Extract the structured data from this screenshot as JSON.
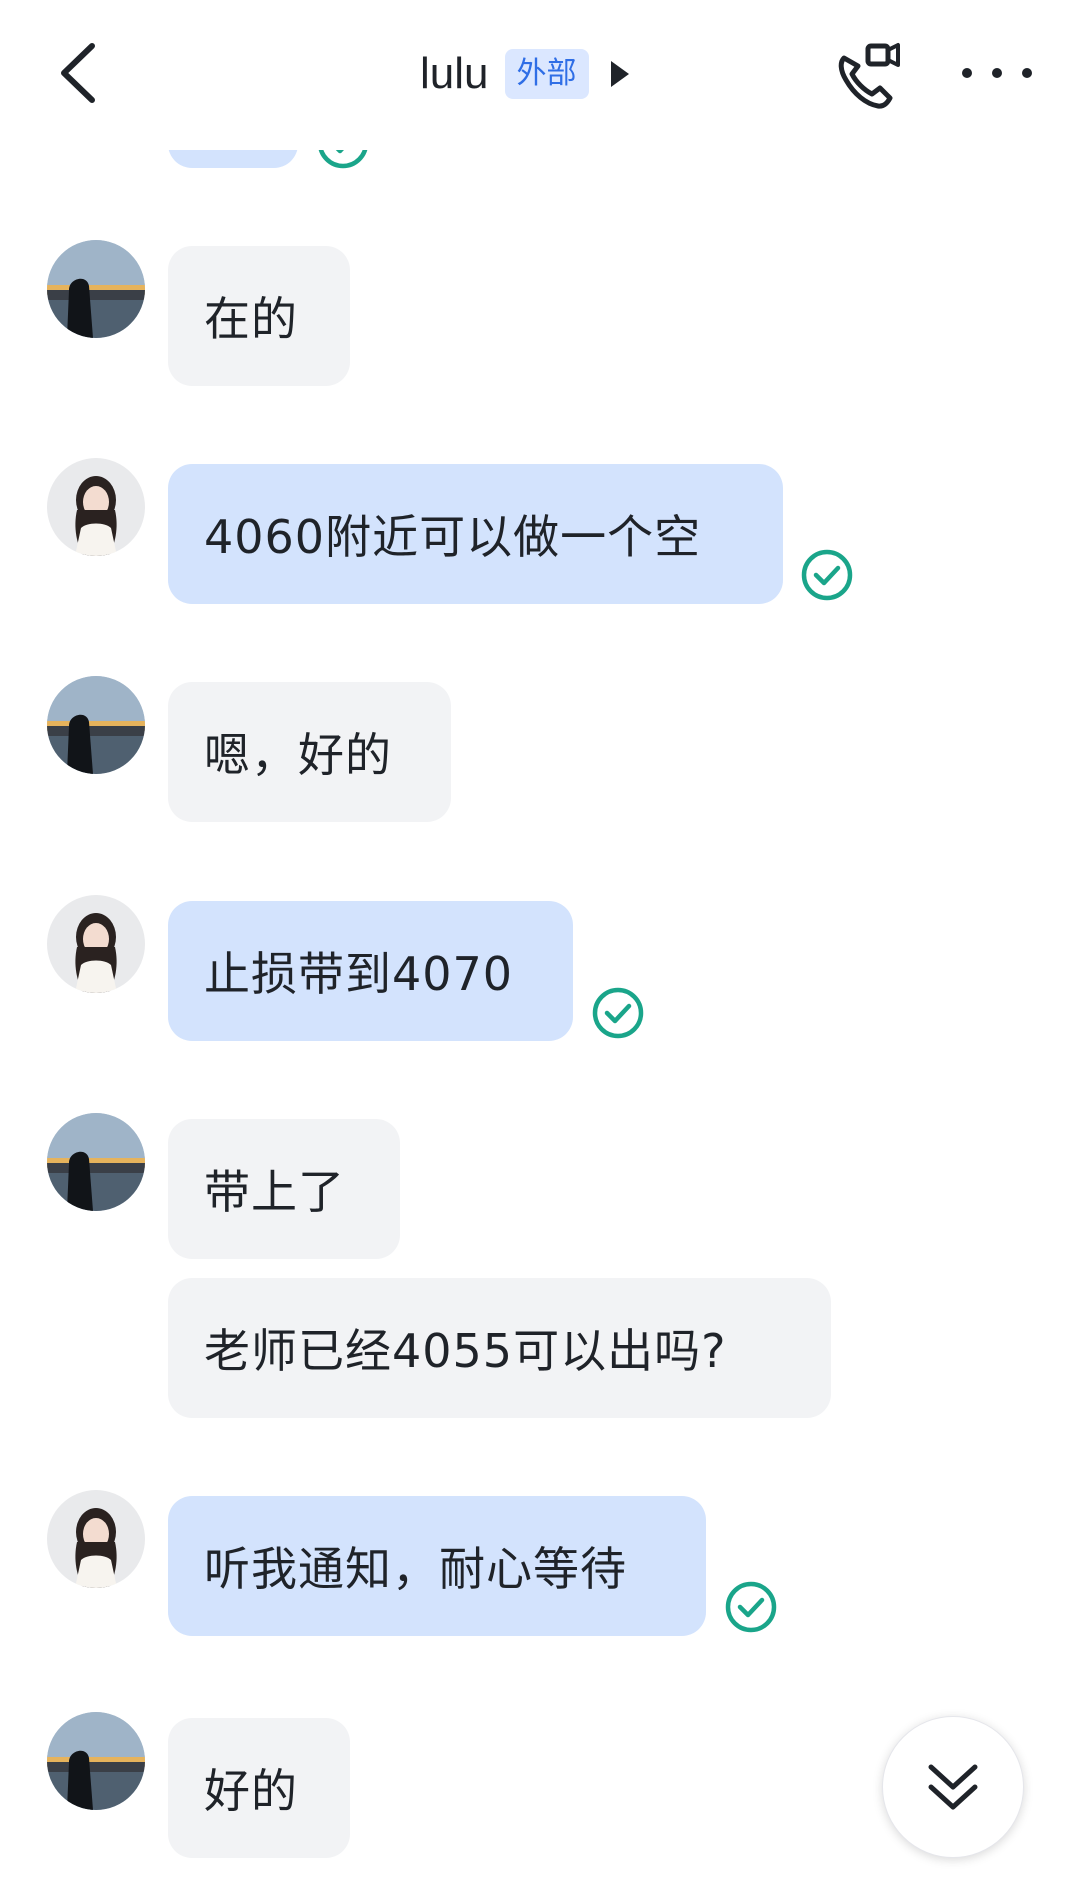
{
  "header": {
    "title": "lulu",
    "tag": "外部"
  },
  "messages": [
    {
      "id": "m1",
      "text": "在的"
    },
    {
      "id": "m2",
      "text": "4060附近可以做一个空"
    },
    {
      "id": "m3",
      "text": "嗯，好的"
    },
    {
      "id": "m4",
      "text": "止损带到4070"
    },
    {
      "id": "m5",
      "text": "带上了"
    },
    {
      "id": "m6",
      "text": "老师已经4055可以出吗?"
    },
    {
      "id": "m7",
      "text": "听我通知，耐心等待"
    },
    {
      "id": "m8",
      "text": "好的"
    }
  ],
  "icons": {
    "back": "chevron-left-icon",
    "call": "phone-video-icon",
    "more": "more-dots-icon",
    "read": "check-circle-icon",
    "scroll": "double-chevron-down-icon"
  },
  "colors": {
    "self_bubble": "#d3e3fd",
    "other_bubble": "#f2f3f5",
    "tag_bg": "#dbe7ff",
    "tag_text": "#2f6ee6",
    "read_check": "#1aa58a"
  }
}
